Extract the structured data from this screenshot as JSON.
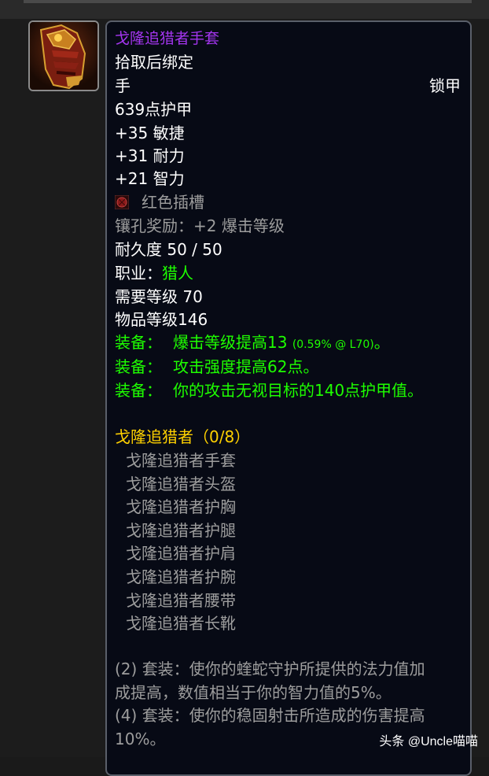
{
  "item": {
    "name": "戈隆追猎者手套",
    "binding": "拾取后绑定",
    "slot": "手",
    "armor_type": "锁甲",
    "armor": "639点护甲",
    "stats": [
      "+35 敏捷",
      "+31 耐力",
      "+21 智力"
    ],
    "socket": "红色插槽",
    "socket_bonus": "镶孔奖励：+2 爆击等级",
    "durability": "耐久度 50 / 50",
    "class_label": "职业：",
    "class_value": "猎人",
    "required_level": "需要等级 70",
    "item_level": "物品等级146",
    "equip": [
      {
        "prefix": "装备：",
        "text": "爆击等级提高13",
        "note": "(0.59% @ L70)",
        "suffix": "。"
      },
      {
        "prefix": "装备：",
        "text": "攻击强度提高62点。",
        "note": "",
        "suffix": ""
      },
      {
        "prefix": "装备：",
        "text": "你的攻击无视目标的140点护甲值。",
        "note": "",
        "suffix": ""
      }
    ]
  },
  "set": {
    "title": "戈隆追猎者（0/8）",
    "pieces": [
      "戈隆追猎者手套",
      "戈隆追猎者头盔",
      "戈隆追猎者护胸",
      "戈隆追猎者护腿",
      "戈隆追猎者护肩",
      "戈隆追猎者护腕",
      "戈隆追猎者腰带",
      "戈隆追猎者长靴"
    ],
    "bonuses": [
      {
        "line1": "(2) 套装：使你的蝰蛇守护所提供的法力值加",
        "line2": "成提高，数值相当于你的智力值的5%。"
      },
      {
        "line1": "(4) 套装：使你的稳固射击所造成的伤害提高",
        "line2": "10%。"
      }
    ]
  },
  "watermark": "头条 @Uncle喵喵",
  "colors": {
    "epic": "#a335ee",
    "equip": "#1eff00",
    "set_title": "#ffd100",
    "inactive": "#9d9d9d"
  },
  "icons": {
    "item_icon": "gauntlet-icon",
    "socket_icon": "red-socket-icon"
  }
}
